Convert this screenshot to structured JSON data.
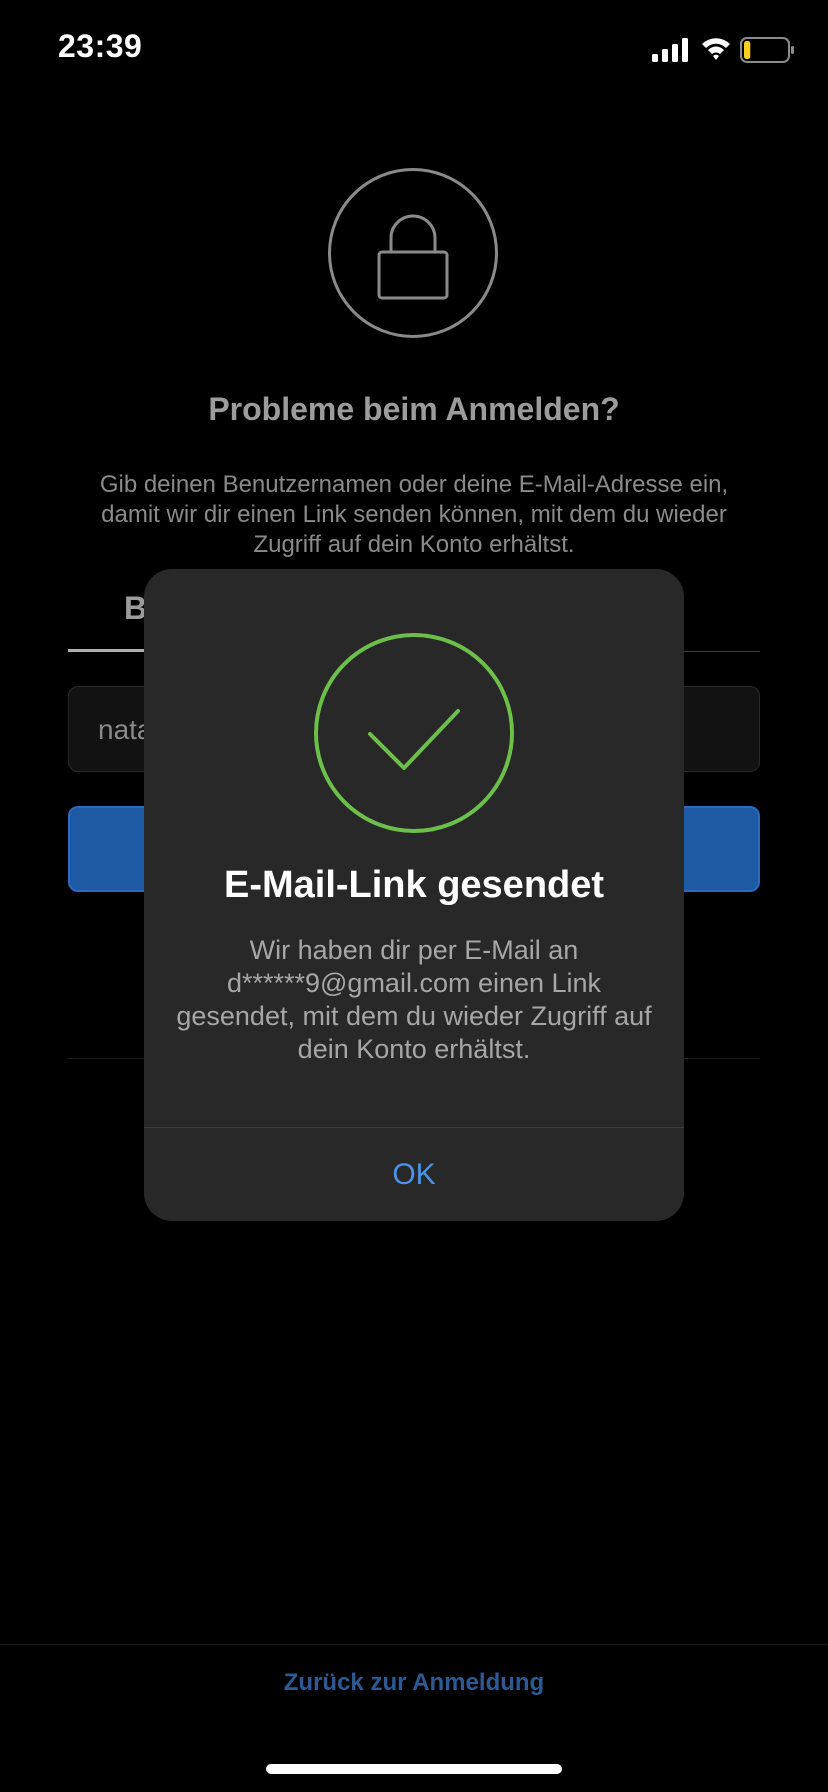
{
  "status_bar": {
    "time": "23:39",
    "icons": [
      "cellular-signal-icon",
      "wifi-icon",
      "battery-icon"
    ],
    "battery_level": 0.15,
    "battery_color": "#f5d020"
  },
  "screen": {
    "icon": "lock-icon",
    "title": "Probleme beim Anmelden?",
    "description": "Gib deinen Benutzernamen oder deine E-Mail-Adresse ein, damit wir dir einen Link senden können, mit dem du wieder Zugriff auf dein Konto erhältst.",
    "tab_partial_label": "B",
    "input_partial_value": "nata",
    "back_link": "Zurück zur Anmeldung"
  },
  "dialog": {
    "icon": "checkmark-icon",
    "icon_color": "#6cc04a",
    "title": "E-Mail-Link gesendet",
    "message": "Wir haben dir per E-Mail an d******9@gmail.com einen Link gesendet, mit dem du wieder Zugriff auf dein Konto erhältst.",
    "ok_label": "OK",
    "ok_color": "#4a93e8"
  }
}
